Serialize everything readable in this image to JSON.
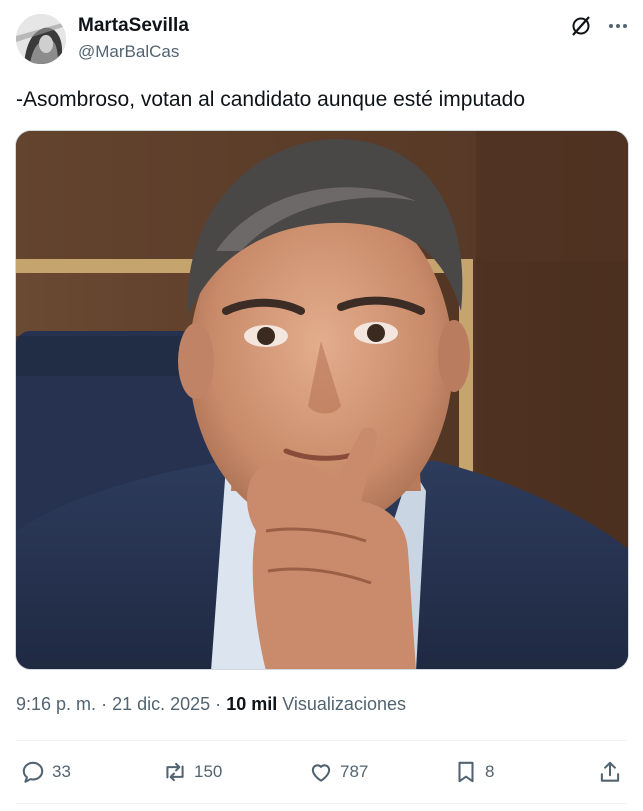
{
  "author": {
    "name": "MartaSevilla",
    "handle": "@MarBalCas"
  },
  "post": {
    "text": "-Asombroso, votan al candidato aunque esté imputado"
  },
  "meta": {
    "time": "9:16 p. m.",
    "separator": "·",
    "date": "21 dic. 2025",
    "views_count": "10 mil",
    "views_label": "Visualizaciones"
  },
  "actions": {
    "replies": "33",
    "reposts": "150",
    "likes": "787",
    "bookmarks": "8"
  },
  "icons": {
    "header": [
      "grok-icon",
      "more-icon"
    ],
    "actions": [
      "reply-icon",
      "repost-icon",
      "like-icon",
      "bookmark-icon",
      "share-icon"
    ]
  },
  "colors": {
    "text_primary": "#0f1419",
    "text_secondary": "#536471",
    "divider": "#eff3f4"
  }
}
